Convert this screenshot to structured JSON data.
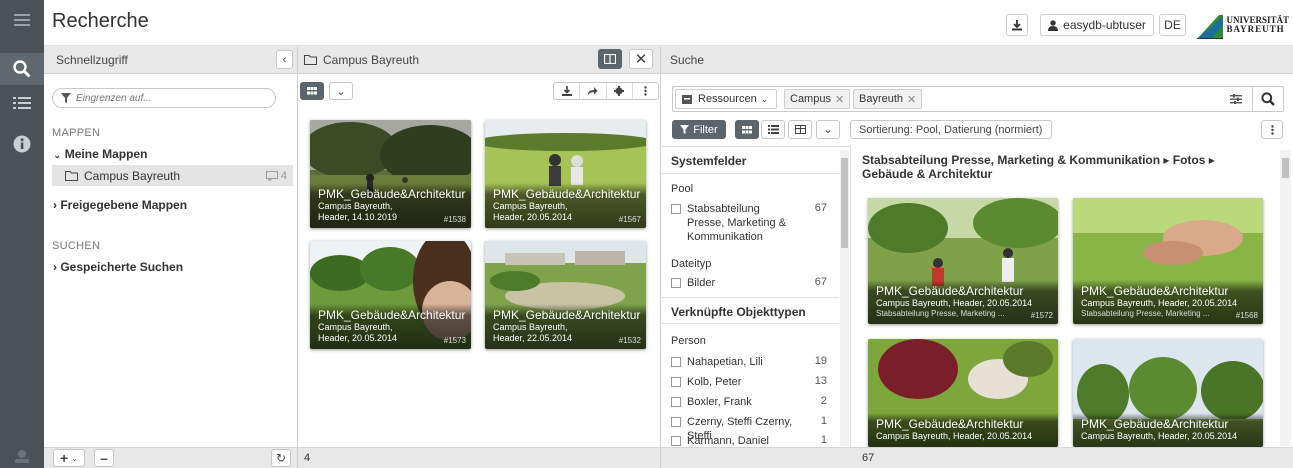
{
  "app": {
    "title": "Recherche"
  },
  "header": {
    "user": "easydb-ubtuser",
    "lang": "DE",
    "logo_line1": "UNIVERSITÄT",
    "logo_line2": "BAYREUTH"
  },
  "rail": {
    "icons": [
      "menu-icon",
      "search-icon",
      "list-icon",
      "info-icon"
    ]
  },
  "left": {
    "title": "Schnellzugriff",
    "filter_placeholder": "Eingrenzen auf...",
    "mappen_label": "MAPPEN",
    "meine_mappen": "Meine Mappen",
    "folder": "Campus Bayreuth",
    "folder_count": "4",
    "freigegebene": "Freigegebene Mappen",
    "suchen_label": "SUCHEN",
    "gespeicherte": "Gespeicherte Suchen"
  },
  "middle": {
    "title": "Campus Bayreuth",
    "footer_count": "4",
    "cards": [
      {
        "title": "PMK_Gebäude&Architektur",
        "line1": "Campus Bayreuth,",
        "line2": "Header, 14.10.2019",
        "num": "#1538"
      },
      {
        "title": "PMK_Gebäude&Architektur",
        "line1": "Campus Bayreuth,",
        "line2": "Header, 20.05.2014",
        "num": "#1567"
      },
      {
        "title": "PMK_Gebäude&Architektur",
        "line1": "Campus Bayreuth,",
        "line2": "Header, 20.05.2014",
        "num": "#1573"
      },
      {
        "title": "PMK_Gebäude&Architektur",
        "line1": "Campus Bayreuth,",
        "line2": "Header, 22.05.2014",
        "num": "#1532"
      }
    ]
  },
  "search": {
    "title": "Suche",
    "resources_label": "Ressourcen",
    "tags": [
      "Campus",
      "Bayreuth"
    ],
    "filter_label": "Filter",
    "sort_label": "Sortierung: Pool, Datierung (normiert)",
    "footer_count": "67",
    "breadcrumb": "Stabsabteilung Presse, Marketing & Kommunikation ▸ Fotos ▸ Gebäude & Architektur",
    "filters": {
      "systemfelder": "Systemfelder",
      "pool_label": "Pool",
      "pool_item": "Stabsabteilung Presse, Marketing & Kommunikation",
      "pool_count": "67",
      "dateityp_label": "Dateityp",
      "dateityp_item": "Bilder",
      "dateityp_count": "67",
      "objekttypen": "Verknüpfte Objekttypen",
      "person_label": "Person",
      "persons": [
        {
          "name": "Nahapetian, Lili",
          "count": "19"
        },
        {
          "name": "Kolb, Peter",
          "count": "13"
        },
        {
          "name": "Boxler, Frank",
          "count": "2"
        },
        {
          "name": "Czerny, Steffi Czerny, Steffi",
          "count": "1"
        },
        {
          "name": "Karmann, Daniel",
          "count": "1"
        }
      ]
    },
    "results": [
      {
        "title": "PMK_Gebäude&Architektur",
        "line1": "Campus Bayreuth, Header, 20.05.2014",
        "line2": "Stabsabteilung Presse, Marketing ...",
        "num": "#1572"
      },
      {
        "title": "PMK_Gebäude&Architektur",
        "line1": "Campus Bayreuth, Header, 20.05.2014",
        "line2": "Stabsabteilung Presse, Marketing ...",
        "num": "#1568"
      },
      {
        "title": "PMK_Gebäude&Architektur",
        "line1": "Campus Bayreuth, Header, 20.05.2014",
        "line2": "",
        "num": ""
      },
      {
        "title": "PMK_Gebäude&Architektur",
        "line1": "Campus Bayreuth, Header, 20.05.2014",
        "line2": "",
        "num": ""
      }
    ]
  }
}
